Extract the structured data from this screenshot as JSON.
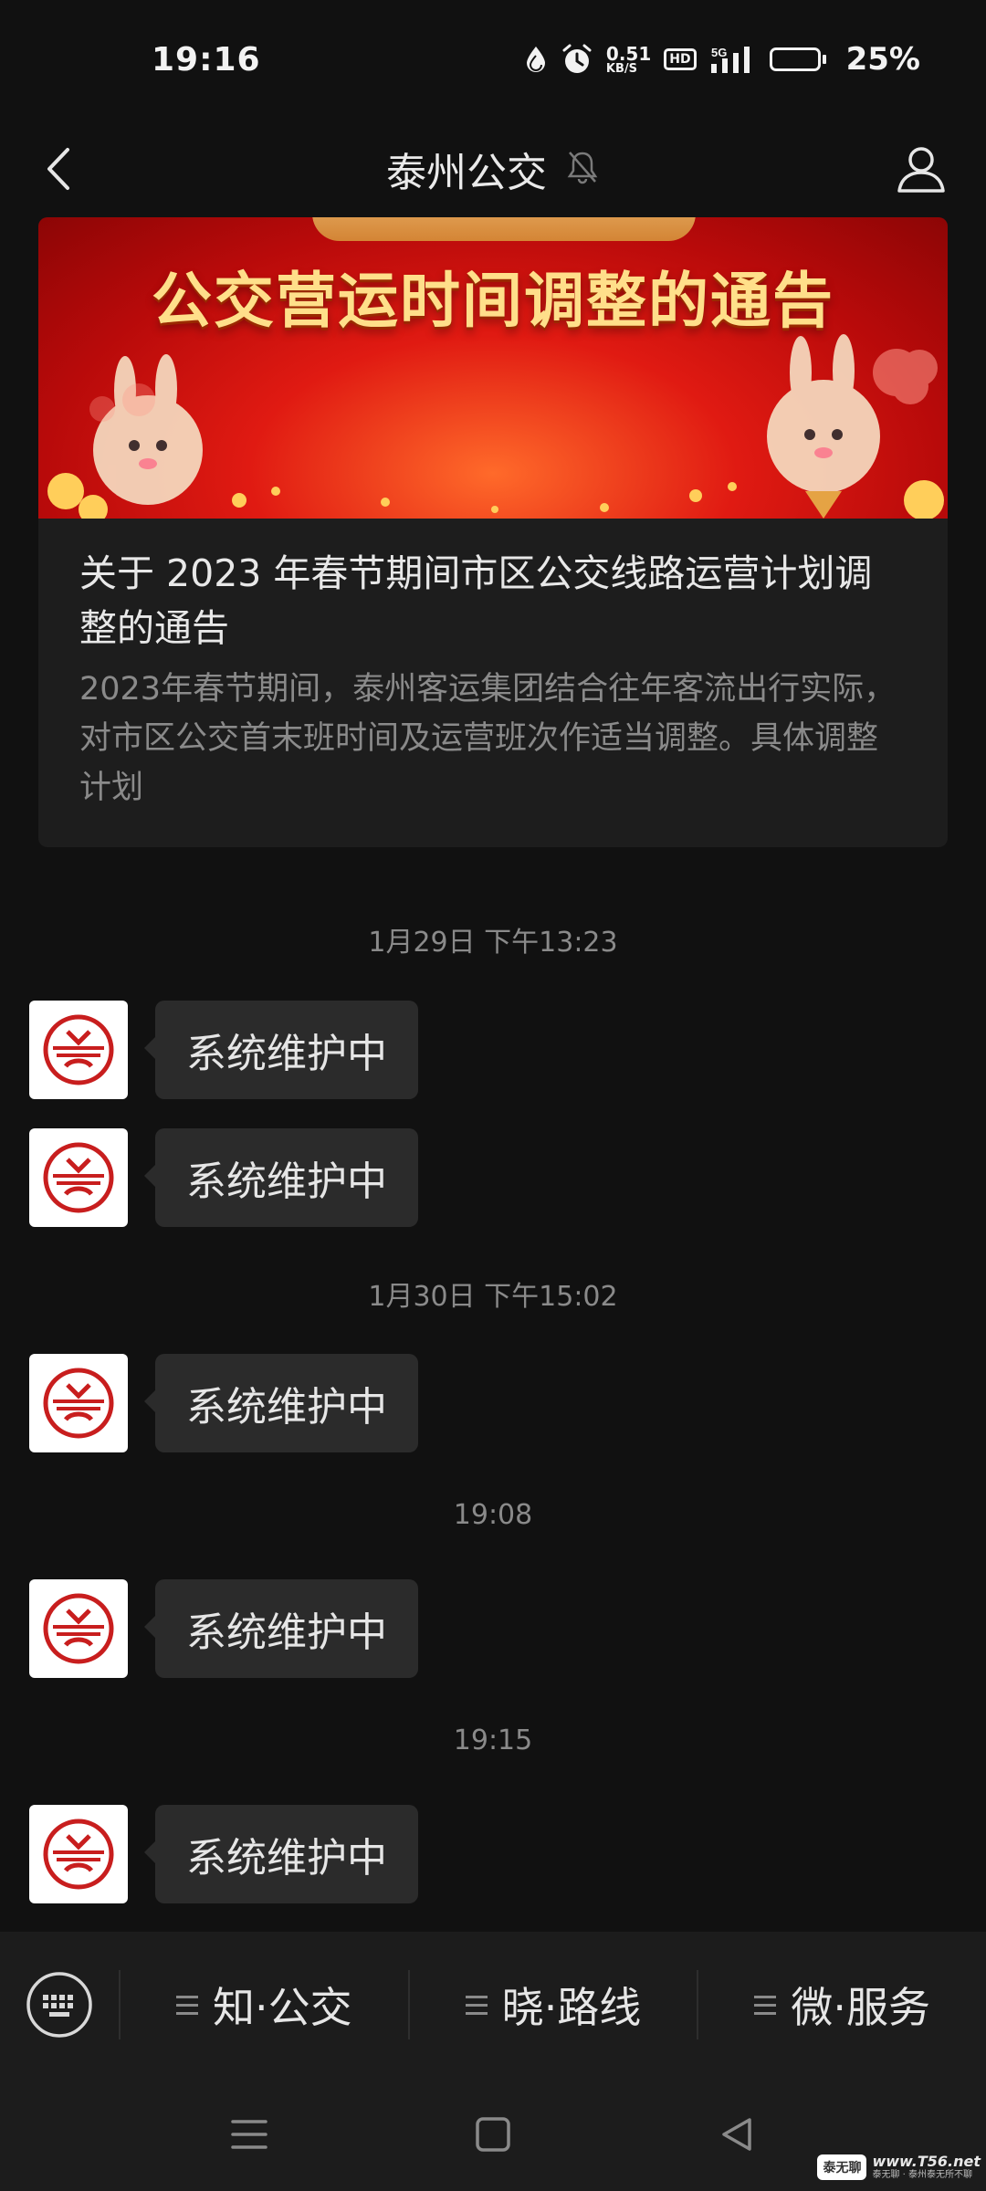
{
  "status_bar": {
    "time": "19:16",
    "net_speed_value": "0.51",
    "net_speed_unit": "KB/S",
    "hd_label": "HD",
    "network_type": "5G",
    "battery_percent": "25%",
    "battery_level": 0.25
  },
  "nav": {
    "title": "泰州公交"
  },
  "article": {
    "banner_title": "公交营运时间调整的通告",
    "title": "关于 2023 年春节期间市区公交线路运营计划调整的通告",
    "summary": "2023年春节期间，泰州客运集团结合往年客流出行实际，对市区公交首末班时间及运营班次作适当调整。具体调整计划"
  },
  "messages": [
    {
      "type": "timestamp",
      "text": "1月29日 下午13:23"
    },
    {
      "type": "message",
      "text": "系统维护中"
    },
    {
      "type": "message",
      "text": "系统维护中"
    },
    {
      "type": "timestamp",
      "text": "1月30日 下午15:02"
    },
    {
      "type": "message",
      "text": "系统维护中"
    },
    {
      "type": "timestamp",
      "text": "19:08"
    },
    {
      "type": "message",
      "text": "系统维护中"
    },
    {
      "type": "timestamp",
      "text": "19:15"
    },
    {
      "type": "message",
      "text": "系统维护中"
    }
  ],
  "menu": {
    "items": [
      {
        "label": "知·公交"
      },
      {
        "label": "晓·路线"
      },
      {
        "label": "微·服务"
      }
    ]
  },
  "watermark": {
    "url": "www.T56.net",
    "sub": "泰无聊 · 泰州泰无所不聊",
    "box": "泰无聊"
  },
  "colors": {
    "background": "#111111",
    "bubble": "#2b2b2b",
    "banner_red": "#e01a12",
    "logo_red": "#c81e1e"
  }
}
